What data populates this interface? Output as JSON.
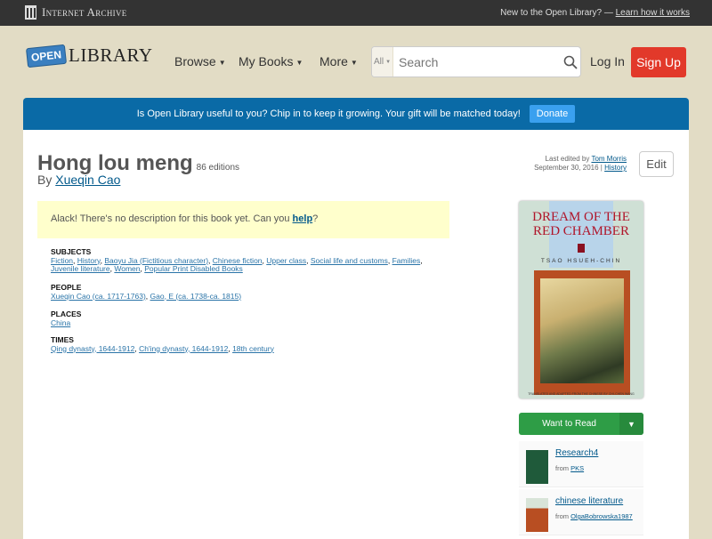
{
  "topbar": {
    "brand": "Internet Archive",
    "new_text": "New to the Open Library? —",
    "learn_link": "Learn how it works"
  },
  "header": {
    "logo_open": "OPEN",
    "logo_library": "LIBRARY",
    "nav": [
      "Browse",
      "My Books",
      "More"
    ],
    "search": {
      "scope": "All",
      "placeholder": "Search"
    },
    "login": "Log In",
    "signup": "Sign Up"
  },
  "banner": {
    "text": "Is Open Library useful to you? Chip in to keep it growing. Your gift will be matched today!",
    "donate": "Donate"
  },
  "work": {
    "title": "Hong lou meng",
    "editions": "86 editions",
    "by": "By",
    "author": "Xueqin Cao",
    "last_edited_prefix": "Last edited by",
    "editor": "Tom Morris",
    "edit_date": "September 30, 2016",
    "sep": "|",
    "history": "History",
    "edit": "Edit",
    "nodesc_before": "Alack! There's no description for this book yet. Can you",
    "nodesc_link": "help",
    "nodesc_after": "?",
    "sections": [
      {
        "heading": "SUBJECTS",
        "items": [
          "Fiction",
          "History",
          "Baoyu Jia (Fictitious character)",
          "Chinese fiction",
          "Upper class",
          "Social life and customs",
          "Families",
          "Juvenile literature",
          "Women",
          "Popular Print Disabled Books"
        ]
      },
      {
        "heading": "PEOPLE",
        "items": [
          "Xueqin Cao (ca. 1717-1763)",
          "Gao, E (ca. 1738-ca. 1815)"
        ]
      },
      {
        "heading": "PLACES",
        "items": [
          "China"
        ]
      },
      {
        "heading": "TIMES",
        "items": [
          "Qing dynasty, 1644-1912",
          "Ch'ing dynasty, 1644-1912",
          "18th century"
        ]
      }
    ]
  },
  "cover": {
    "title": "DREAM OF THE RED CHAMBER",
    "author": "TSAO HSUEH-CHIN",
    "translator": "TRANSLATED AND ADAPTED FROM THE CHINESE BY CHI-CHEN WANG"
  },
  "want_to_read": "Want to Read",
  "lists": [
    {
      "name": "Research4",
      "from": "from",
      "owner": "PKS"
    },
    {
      "name": "chinese literature",
      "from": "from",
      "owner": "OlgaBobrowska1987"
    }
  ]
}
